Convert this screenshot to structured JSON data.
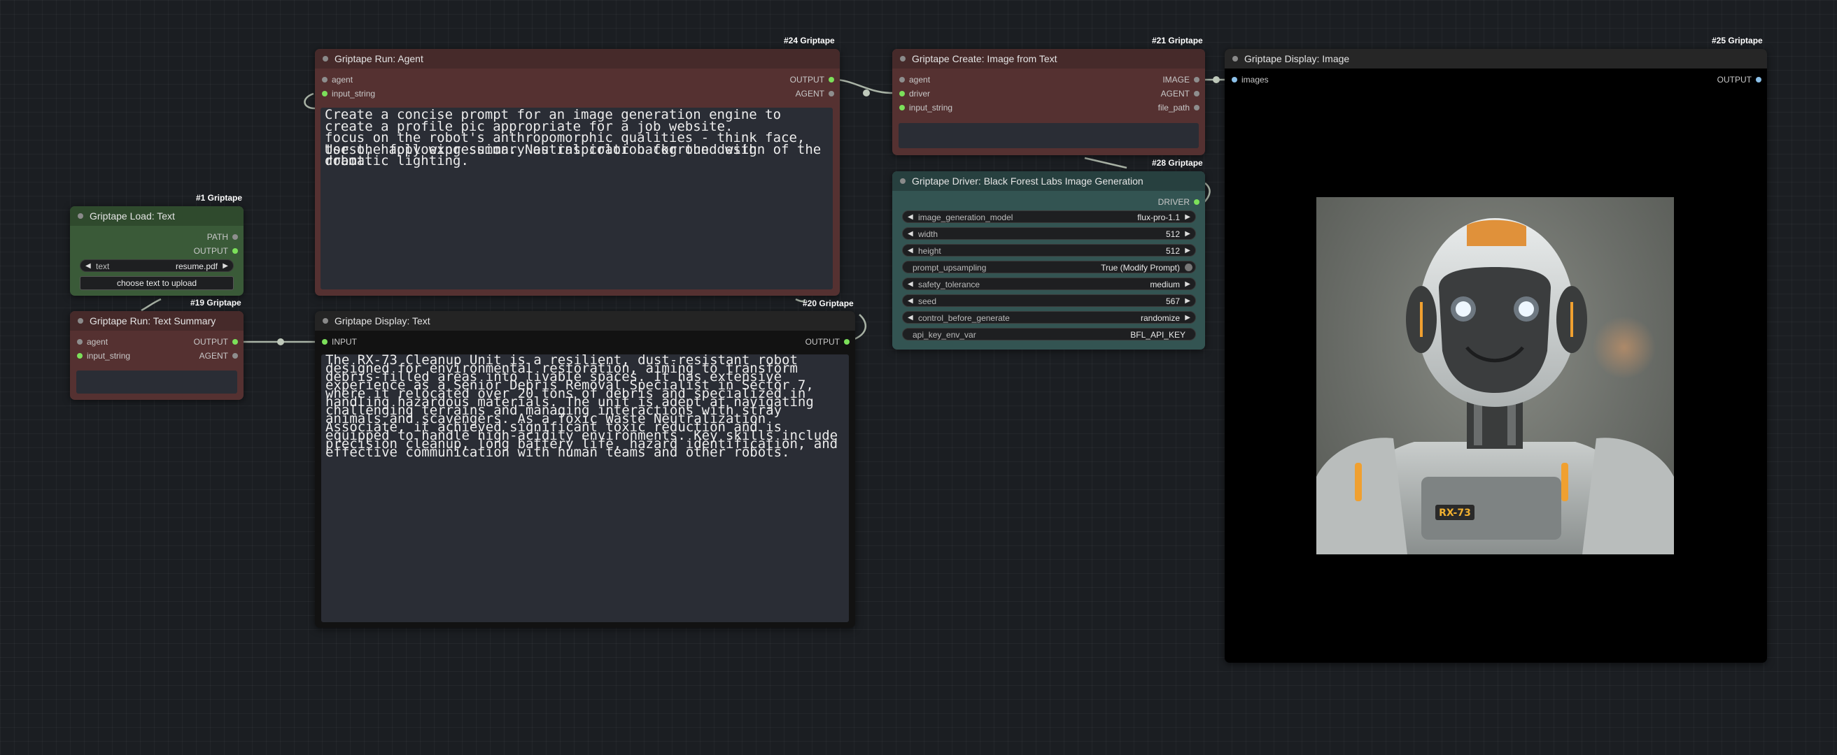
{
  "badges": {
    "n24": "#24 Griptape",
    "n21": "#21 Griptape",
    "n25": "#25 Griptape",
    "n28": "#28 Griptape",
    "n1": "#1 Griptape",
    "n19": "#19 Griptape",
    "n20": "#20 Griptape"
  },
  "run_agent": {
    "title": "Griptape Run: Agent",
    "in_agent": "agent",
    "in_input_string": "input_string",
    "out_output": "OUTPUT",
    "out_agent": "AGENT",
    "text_layer1": "Create a concise prompt for an image generation engine to create a profile pic appropriate for a job website.\nfocus on the robot's anthropomorphic qualities - think face, torso, happy expression. Neutral color background with dramatic lighting.",
    "text_layer2": "\n\n\nUse the following summary as inspiration for the design of the robot."
  },
  "create_image": {
    "title": "Griptape Create: Image from Text",
    "in_agent": "agent",
    "in_driver": "driver",
    "in_input_string": "input_string",
    "out_image": "IMAGE",
    "out_agent": "AGENT",
    "out_file_path": "file_path"
  },
  "display_image": {
    "title": "Griptape Display: Image",
    "in_images": "images",
    "out_output": "OUTPUT",
    "robot_badge": "RX-73"
  },
  "driver": {
    "title": "Griptape Driver: Black Forest Labs Image Generation",
    "out_driver": "DRIVER",
    "widgets": [
      {
        "name": "image_generation_model",
        "value": "flux-pro-1.1"
      },
      {
        "name": "width",
        "value": "512"
      },
      {
        "name": "height",
        "value": "512"
      },
      {
        "name": "prompt_upsampling",
        "value": "True (Modify Prompt)"
      },
      {
        "name": "safety_tolerance",
        "value": "medium"
      },
      {
        "name": "seed",
        "value": "567"
      },
      {
        "name": "control_before_generate",
        "value": "randomize"
      },
      {
        "name": "api_key_env_var",
        "value": "BFL_API_KEY"
      }
    ]
  },
  "load_text": {
    "title": "Griptape Load: Text",
    "out_path": "PATH",
    "out_output": "OUTPUT",
    "widget_name": "text",
    "widget_value": "resume.pdf",
    "upload_button": "choose text to upload"
  },
  "text_summary": {
    "title": "Griptape Run: Text Summary",
    "in_agent": "agent",
    "in_input_string": "input_string",
    "out_output": "OUTPUT",
    "out_agent": "AGENT"
  },
  "display_text": {
    "title": "Griptape Display: Text",
    "in_input": "INPUT",
    "out_output": "OUTPUT",
    "text_layer1": "The RX-73 Cleanup Unit is a resilient, dust-resistant robot designed for environmental restoration, aiming to transform debris-filled areas into livable spaces. It has extensive experience as a Senior Debris Removal Specialist in Sector 7, where it relocated over 20 tons of debris and specialized in handling hazardous materials. The unit is adept at navigating challenging terrains and managing interactions with stray animals and scavengers. As a Toxic Waste Neutralization Associate, it achieved significant toxic reduction and is equipped to handle high-acidity environments. Key skills include precision cleanup, long battery life, hazard identification, and effective communication with human teams and other robots.",
    "text_layer2": "\n\n\n\n\n\n\n\n\n\n\n\n"
  },
  "colors": {
    "node_red": "#553131",
    "node_green": "#3a5a38",
    "node_teal": "#335452",
    "slot_connected": "#7ce05a",
    "wire": "#a9b9a4",
    "robot_accent": "#e0913a"
  }
}
